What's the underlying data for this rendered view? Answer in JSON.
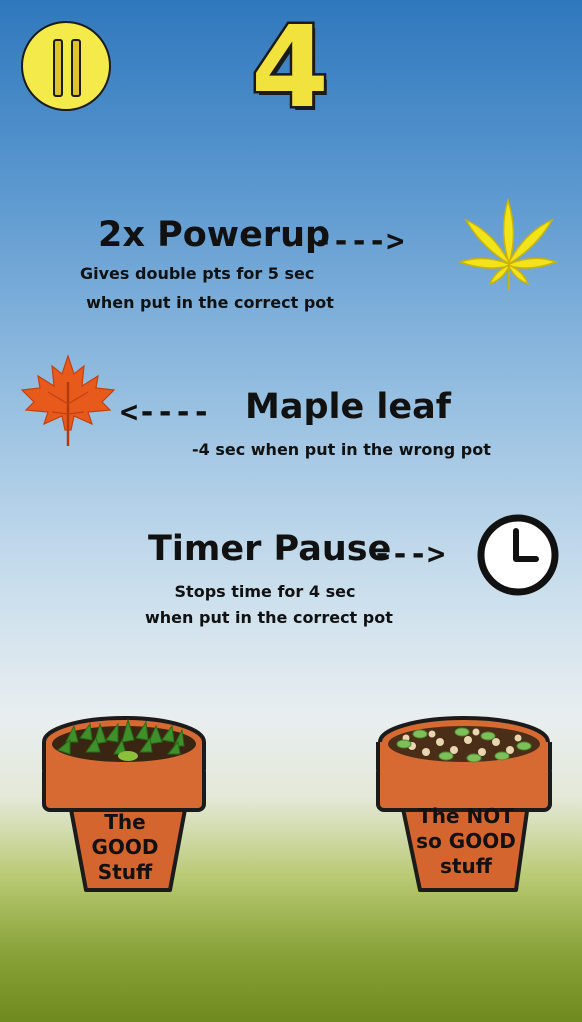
{
  "hud": {
    "countdown": "4"
  },
  "powerup": {
    "title": "2x  Powerup",
    "arrow": "---->",
    "description_line1": "Gives double pts for 5 sec",
    "description_line2": "when put in the correct pot",
    "icon": "gold-cannabis-leaf-icon"
  },
  "maple": {
    "title": "Maple leaf",
    "arrow": "<----",
    "description": "-4 sec when put in the wrong pot",
    "icon": "maple-leaf-icon"
  },
  "timer": {
    "title": "Timer  Pause",
    "arrow": "--->",
    "description_line1": "Stops time for 4 sec",
    "description_line2": "when put in the correct pot",
    "icon": "clock-icon"
  },
  "pots": {
    "good": "The GOOD\nStuff",
    "bad": "The NOT\nso GOOD\nstuff"
  },
  "colors": {
    "sky_top": "#2f78bd",
    "grass": "#6f8a1f",
    "pot": "#d4652f",
    "pause_button": "#f4ea4a",
    "countdown": "#f2e23d"
  }
}
